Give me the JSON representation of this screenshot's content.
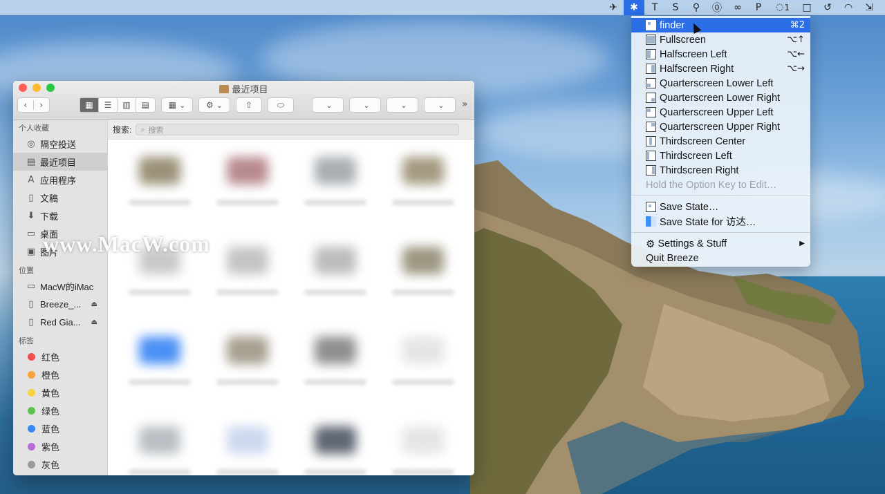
{
  "menubar": {
    "items": [
      {
        "icon": "paper-plane-icon",
        "glyph": "✈"
      },
      {
        "icon": "breeze-icon",
        "glyph": "✱",
        "active": true
      },
      {
        "icon": "text-icon",
        "glyph": "T"
      },
      {
        "icon": "s-icon",
        "glyph": "S"
      },
      {
        "icon": "fork-icon",
        "glyph": "⚲"
      },
      {
        "icon": "one-password-icon",
        "glyph": "⓪"
      },
      {
        "icon": "creative-cloud-icon",
        "glyph": "∞"
      },
      {
        "icon": "p-icon",
        "glyph": "P"
      },
      {
        "icon": "chat-icon",
        "glyph": "◌",
        "count": "1"
      },
      {
        "icon": "window-icon",
        "glyph": "□"
      },
      {
        "icon": "time-machine-icon",
        "glyph": "↺"
      },
      {
        "icon": "wifi-icon",
        "glyph": "◠"
      },
      {
        "icon": "more-icon",
        "glyph": "⇲"
      }
    ]
  },
  "breeze_menu": {
    "items": [
      {
        "label": "finder",
        "shortcut": "⌘2",
        "highlighted": true
      },
      {
        "label": "Fullscreen",
        "shortcut": "⌥↑"
      },
      {
        "label": "Halfscreen Left",
        "shortcut": "⌥←"
      },
      {
        "label": "Halfscreen Right",
        "shortcut": "⌥→"
      },
      {
        "label": "Quarterscreen Lower Left",
        "shortcut": ""
      },
      {
        "label": "Quarterscreen Lower Right",
        "shortcut": ""
      },
      {
        "label": "Quarterscreen Upper Left",
        "shortcut": ""
      },
      {
        "label": "Quarterscreen Upper Right",
        "shortcut": ""
      },
      {
        "label": "Thirdscreen Center",
        "shortcut": ""
      },
      {
        "label": "Thirdscreen Left",
        "shortcut": ""
      },
      {
        "label": "Thirdscreen Right",
        "shortcut": ""
      }
    ],
    "hint": "Hold the Option Key to Edit…",
    "save_state": "Save State…",
    "save_state_for": "Save State for 访达…",
    "settings": "Settings & Stuff",
    "quit": "Quit Breeze",
    "highlight_color": "#2b6ee6"
  },
  "finder": {
    "title": "最近项目",
    "search_label": "搜索:",
    "search_placeholder": "搜索",
    "sections": {
      "favorites": "个人收藏",
      "locations": "位置",
      "tags": "标签"
    },
    "favorites": [
      {
        "label": "隔空投送",
        "icon": "airdrop-icon",
        "glyph": "◎"
      },
      {
        "label": "最近项目",
        "icon": "recents-icon",
        "glyph": "▤",
        "selected": true
      },
      {
        "label": "应用程序",
        "icon": "applications-icon",
        "glyph": "A"
      },
      {
        "label": "文稿",
        "icon": "documents-icon",
        "glyph": "▯"
      },
      {
        "label": "下载",
        "icon": "downloads-icon",
        "glyph": "⬇"
      },
      {
        "label": "桌面",
        "icon": "desktop-icon",
        "glyph": "▭"
      },
      {
        "label": "图片",
        "icon": "pictures-icon",
        "glyph": "▣"
      }
    ],
    "locations": [
      {
        "label": "MacW的iMac",
        "icon": "imac-icon",
        "glyph": "▭",
        "eject": false
      },
      {
        "label": "Breeze_...",
        "icon": "disk-icon",
        "glyph": "▯",
        "eject": true
      },
      {
        "label": "Red Gia...",
        "icon": "disk-icon",
        "glyph": "▯",
        "eject": true
      }
    ],
    "tags": [
      {
        "label": "红色",
        "color": "#f0514c"
      },
      {
        "label": "橙色",
        "color": "#f7a23b"
      },
      {
        "label": "黄色",
        "color": "#f7d33d"
      },
      {
        "label": "绿色",
        "color": "#5dc152"
      },
      {
        "label": "蓝色",
        "color": "#3a88f3"
      },
      {
        "label": "紫色",
        "color": "#b86bd9"
      },
      {
        "label": "灰色",
        "color": "#9a9a9a"
      }
    ]
  },
  "watermark": "www.MacW.com"
}
